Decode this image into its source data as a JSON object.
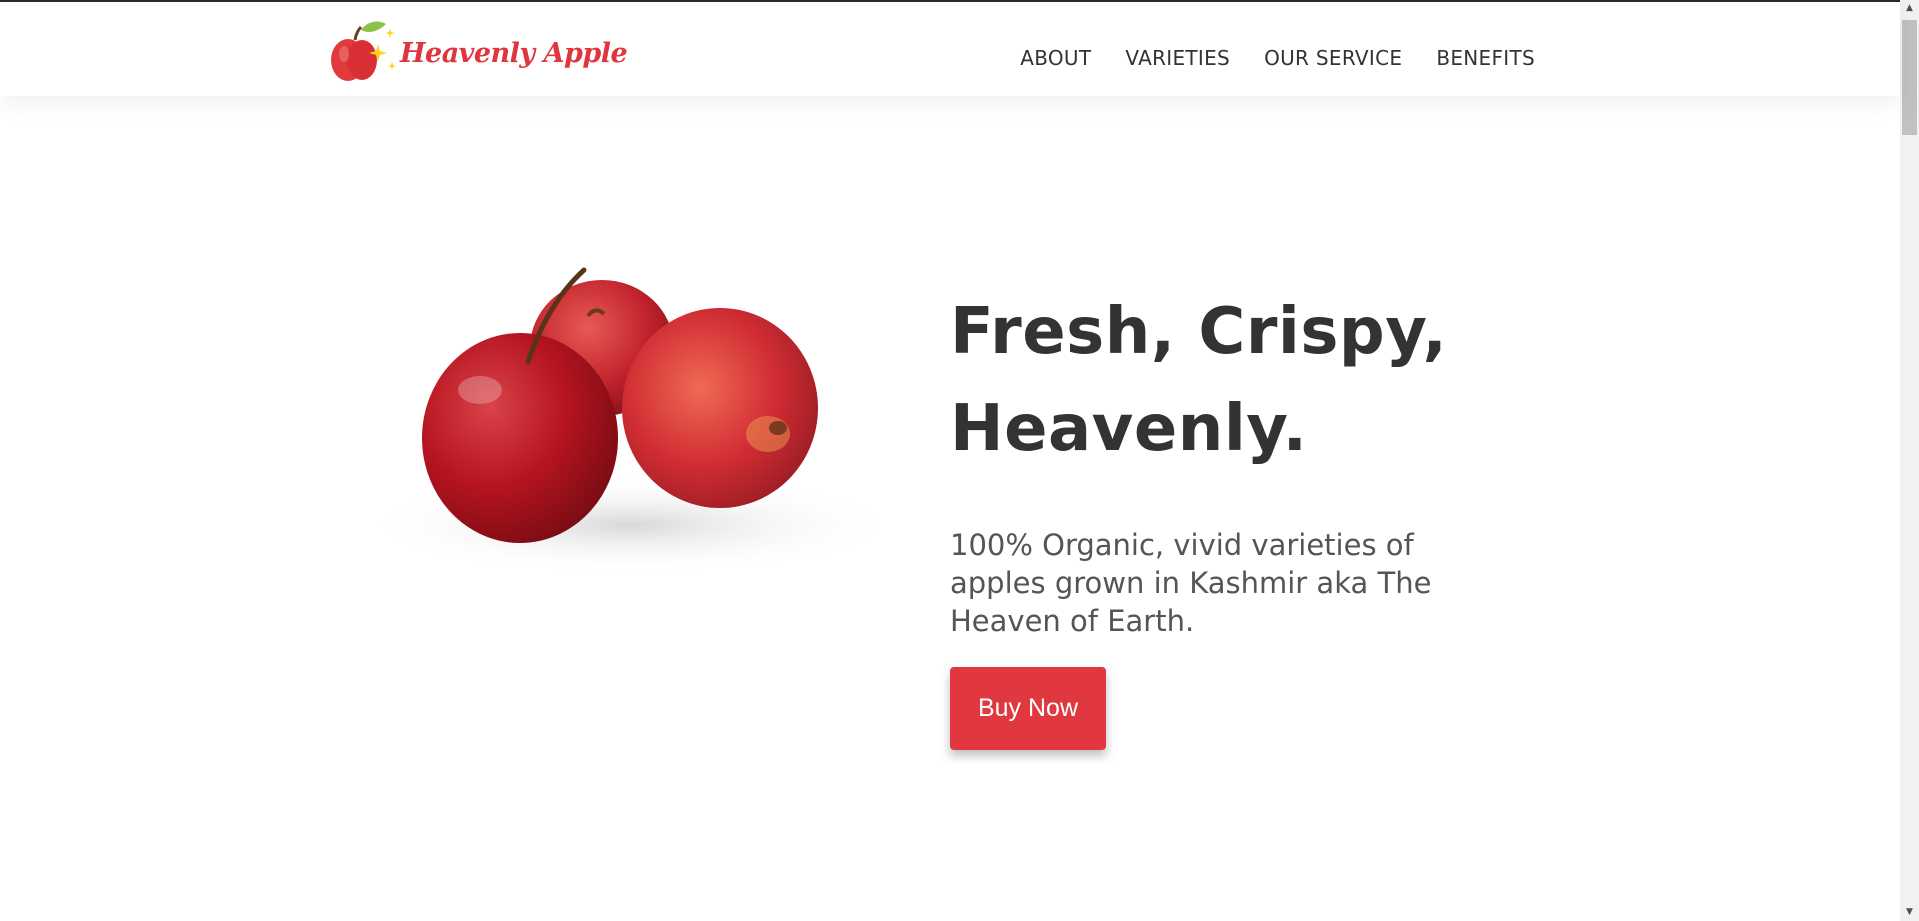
{
  "brand": {
    "name": "Heavenly Apple",
    "logo_icon": "apple-sparkle-icon",
    "color": "#e0353e"
  },
  "nav": {
    "items": [
      {
        "label": "ABOUT"
      },
      {
        "label": "VARIETIES"
      },
      {
        "label": "OUR SERVICE"
      },
      {
        "label": "BENEFITS"
      }
    ]
  },
  "hero": {
    "image": "three-red-apples",
    "headline_line1": "Fresh, Crispy,",
    "headline_line2": "Heavenly.",
    "subtext": "100% Organic, vivid varieties of apples grown in Kashmir aka The Heaven of Earth.",
    "cta_label": "Buy Now",
    "cta_color": "#e0383e"
  },
  "scrollbar": {
    "up_icon": "scroll-up-arrow-icon",
    "down_icon": "scroll-down-arrow-icon"
  }
}
